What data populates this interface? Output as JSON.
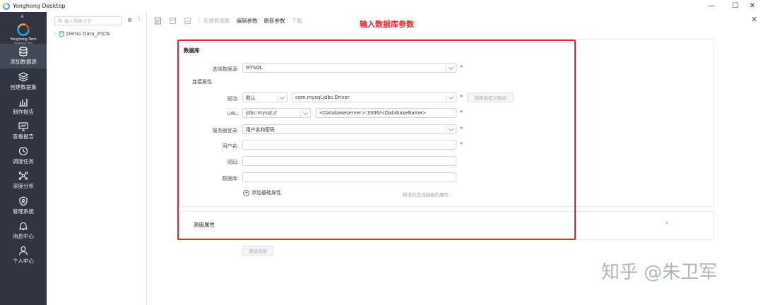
{
  "window": {
    "title": "Yonghong Desktop",
    "controls": [
      "—",
      "☐",
      "✕"
    ]
  },
  "brand": {
    "name": "Yonghong Tech",
    "sub": "Yonghong Tech"
  },
  "nav": {
    "items": [
      {
        "label": "添加数据源",
        "icon": "database-icon",
        "active": true
      },
      {
        "label": "创建数据集",
        "icon": "dataset-icon"
      },
      {
        "label": "制作报告",
        "icon": "chart-icon"
      },
      {
        "label": "查看报告",
        "icon": "monitor-icon"
      },
      {
        "label": "调度任务",
        "icon": "clock-icon"
      },
      {
        "label": "深度分析",
        "icon": "network-icon"
      },
      {
        "label": "管理系统",
        "icon": "shield-icon"
      },
      {
        "label": "消息中心",
        "icon": "bell-icon"
      },
      {
        "label": "个人中心",
        "icon": "user-icon"
      }
    ]
  },
  "tree": {
    "search_placeholder": "输入搜索文字",
    "node": "Demo Data_zhCN"
  },
  "toolbar": {
    "new_datasource": "新建数据集",
    "edit_params": "编辑参数",
    "refresh_params": "刷新参数",
    "download": "下载"
  },
  "annotation": "输入数据库参数",
  "form": {
    "section_database": "数据库",
    "select_source_label": "选择数据源:",
    "select_source_value": "MYSQL",
    "connection_props": "连接属性",
    "driver_label": "驱动:",
    "driver_mode": "默认",
    "driver_class": "com.mysql.jdbc.Driver",
    "custom_driver_button": "选择自定义驱动",
    "url_label": "URL:",
    "url_prefix": "jdbc:mysql://",
    "url_value": "<Databaseserver>:3306/<DatabaseName>",
    "login_label": "服务器登录:",
    "login_value": "用户名和密码",
    "username_label": "用户名:",
    "password_label": "密码:",
    "dbname_label": "数据库:",
    "add_property": "添加基础属性",
    "hint": "新增的是连接级的属性",
    "advanced": "高级属性",
    "test_button": "测试连接",
    "required_mark": "*"
  },
  "watermark": "知乎 @朱卫军",
  "colors": {
    "nav_bg": "#2f3642",
    "nav_active": "#414a59",
    "annotation_red": "#e0262b"
  }
}
